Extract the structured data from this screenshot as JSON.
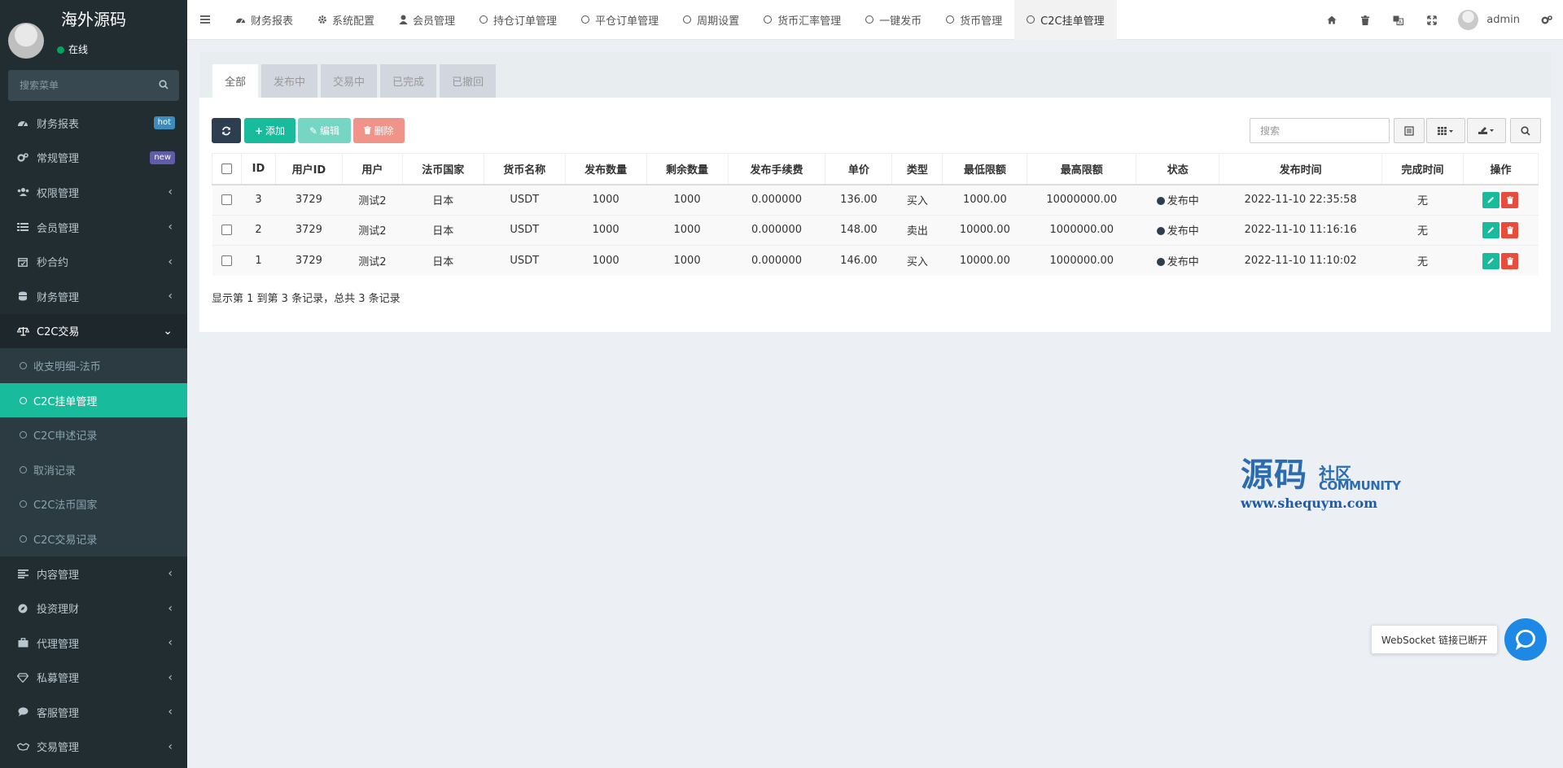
{
  "sidebar": {
    "logo": "海外源码",
    "status": "在线",
    "search_placeholder": "搜索菜单",
    "items": [
      {
        "label": "财务报表",
        "badge": "hot"
      },
      {
        "label": "常规管理",
        "badge": "new"
      },
      {
        "label": "权限管理"
      },
      {
        "label": "会员管理"
      },
      {
        "label": "秒合约"
      },
      {
        "label": "财务管理"
      },
      {
        "label": "C2C交易"
      },
      {
        "label": "内容管理"
      },
      {
        "label": "投资理财"
      },
      {
        "label": "代理管理"
      },
      {
        "label": "私募管理"
      },
      {
        "label": "客服管理"
      },
      {
        "label": "交易管理"
      }
    ],
    "c2c_sub": [
      {
        "label": "收支明细-法币"
      },
      {
        "label": "C2C挂单管理"
      },
      {
        "label": "C2C申述记录"
      },
      {
        "label": "取消记录"
      },
      {
        "label": "C2C法币国家"
      },
      {
        "label": "C2C交易记录"
      }
    ]
  },
  "navbar": {
    "tabs": [
      {
        "label": "财务报表"
      },
      {
        "label": "系统配置"
      },
      {
        "label": "会员管理"
      },
      {
        "label": "持仓订单管理"
      },
      {
        "label": "平仓订单管理"
      },
      {
        "label": "周期设置"
      },
      {
        "label": "货币汇率管理"
      },
      {
        "label": "一键发币"
      },
      {
        "label": "货币管理"
      },
      {
        "label": "C2C挂单管理"
      }
    ],
    "user": "admin"
  },
  "panel": {
    "filter_tabs": [
      "全部",
      "发布中",
      "交易中",
      "已完成",
      "已撤回"
    ],
    "buttons": {
      "add": "添加",
      "edit": "编辑",
      "delete": "删除"
    },
    "search_placeholder": "搜索",
    "columns": [
      "ID",
      "用户ID",
      "用户",
      "法币国家",
      "货币名称",
      "发布数量",
      "剩余数量",
      "发布手续费",
      "单价",
      "类型",
      "最低限额",
      "最高限额",
      "状态",
      "发布时间",
      "完成时间",
      "操作"
    ],
    "rows": [
      {
        "id": "3",
        "uid": "3729",
        "user": "测试2",
        "country": "日本",
        "currency": "USDT",
        "qty": "1000",
        "remain": "1000",
        "fee": "0.000000",
        "price": "136.00",
        "type": "买入",
        "min": "1000.00",
        "max": "10000000.00",
        "status": "发布中",
        "time": "2022-11-10 22:35:58",
        "done": "无"
      },
      {
        "id": "2",
        "uid": "3729",
        "user": "测试2",
        "country": "日本",
        "currency": "USDT",
        "qty": "1000",
        "remain": "1000",
        "fee": "0.000000",
        "price": "148.00",
        "type": "卖出",
        "min": "10000.00",
        "max": "1000000.00",
        "status": "发布中",
        "time": "2022-11-10 11:16:16",
        "done": "无"
      },
      {
        "id": "1",
        "uid": "3729",
        "user": "测试2",
        "country": "日本",
        "currency": "USDT",
        "qty": "1000",
        "remain": "1000",
        "fee": "0.000000",
        "price": "146.00",
        "type": "买入",
        "min": "10000.00",
        "max": "1000000.00",
        "status": "发布中",
        "time": "2022-11-10 11:10:02",
        "done": "无"
      }
    ],
    "pager_info": "显示第 1 到第 3 条记录，总共 3 条记录"
  },
  "watermark": {
    "big": "源码",
    "small": "社区",
    "community": "COMMUNITY",
    "url": "www.shequym.com"
  },
  "toast": "WebSocket 链接已断开"
}
